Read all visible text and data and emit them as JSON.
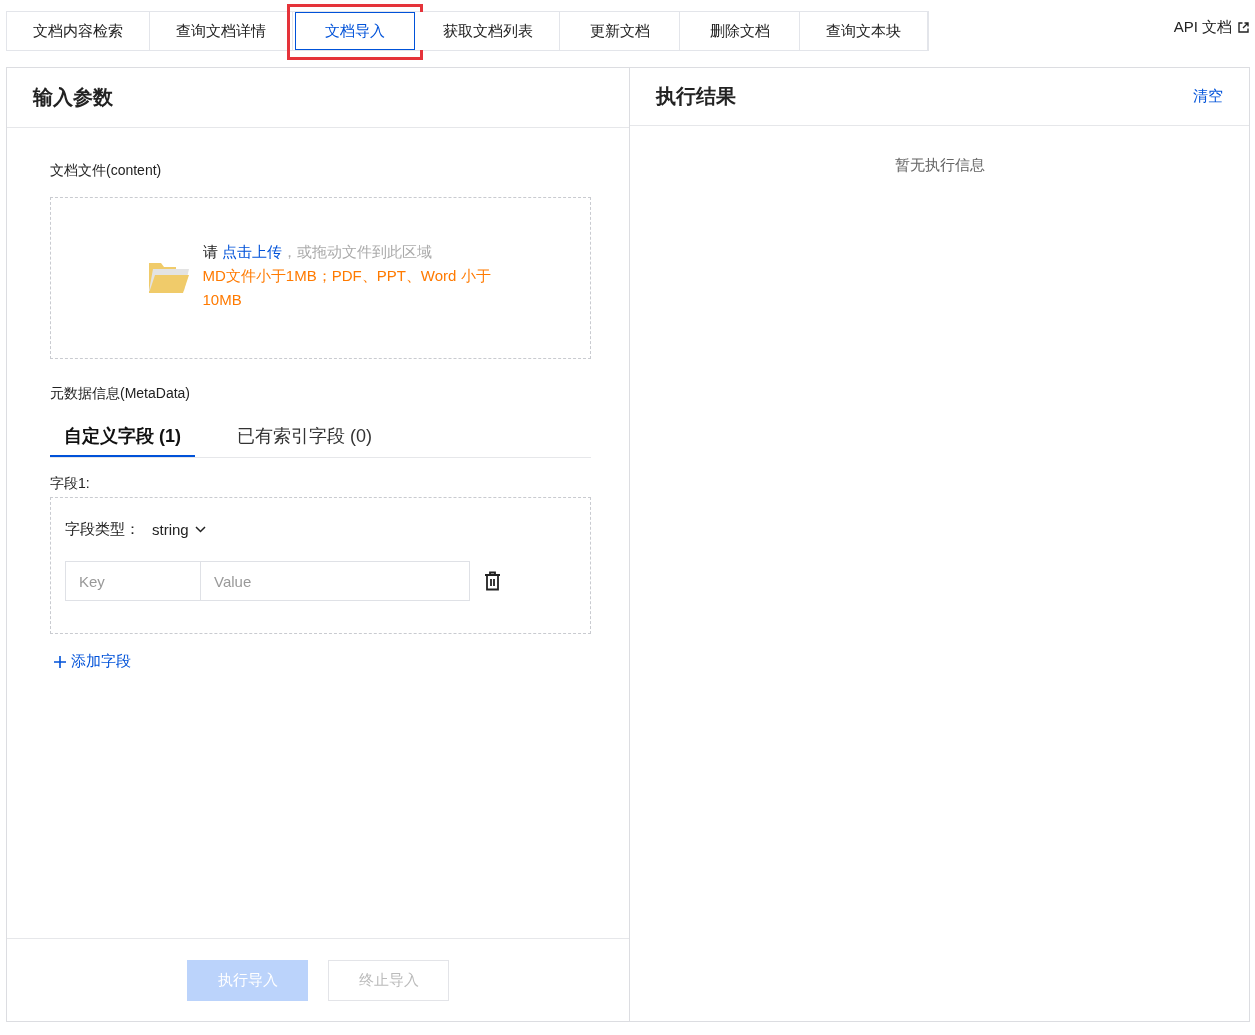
{
  "tabs": [
    {
      "label": "文档内容检索",
      "selected": false,
      "highlighted": false
    },
    {
      "label": "查询文档详情",
      "selected": false,
      "highlighted": false
    },
    {
      "label": "文档导入",
      "selected": true,
      "highlighted": true
    },
    {
      "label": "获取文档列表",
      "selected": false,
      "highlighted": false
    },
    {
      "label": "更新文档",
      "selected": false,
      "highlighted": false
    },
    {
      "label": "删除文档",
      "selected": false,
      "highlighted": false
    },
    {
      "label": "查询文本块",
      "selected": false,
      "highlighted": false
    }
  ],
  "api_link": "API 文档",
  "input_panel": {
    "title": "输入参数",
    "file_label": "文档文件(content)",
    "upload": {
      "prefix": "请 ",
      "link": "点击上传",
      "suffix": "，或拖动文件到此区域",
      "hint": "MD文件小于1MB；PDF、PPT、Word 小于10MB"
    },
    "metadata_label": "元数据信息(MetaData)",
    "meta_tabs": [
      {
        "label": "自定义字段 (1)",
        "selected": true
      },
      {
        "label": "已有索引字段 (0)",
        "selected": false
      }
    ],
    "fields": [
      {
        "label": "字段1:",
        "type_label": "字段类型：",
        "type_value": "string",
        "key_placeholder": "Key",
        "value_placeholder": "Value"
      }
    ],
    "add_field": "添加字段",
    "buttons": [
      {
        "label": "执行导入",
        "kind": "primary",
        "disabled": true
      },
      {
        "label": "终止导入",
        "kind": "secondary",
        "disabled": true
      }
    ]
  },
  "result_panel": {
    "title": "执行结果",
    "clear": "清空",
    "empty": "暂无执行信息"
  }
}
